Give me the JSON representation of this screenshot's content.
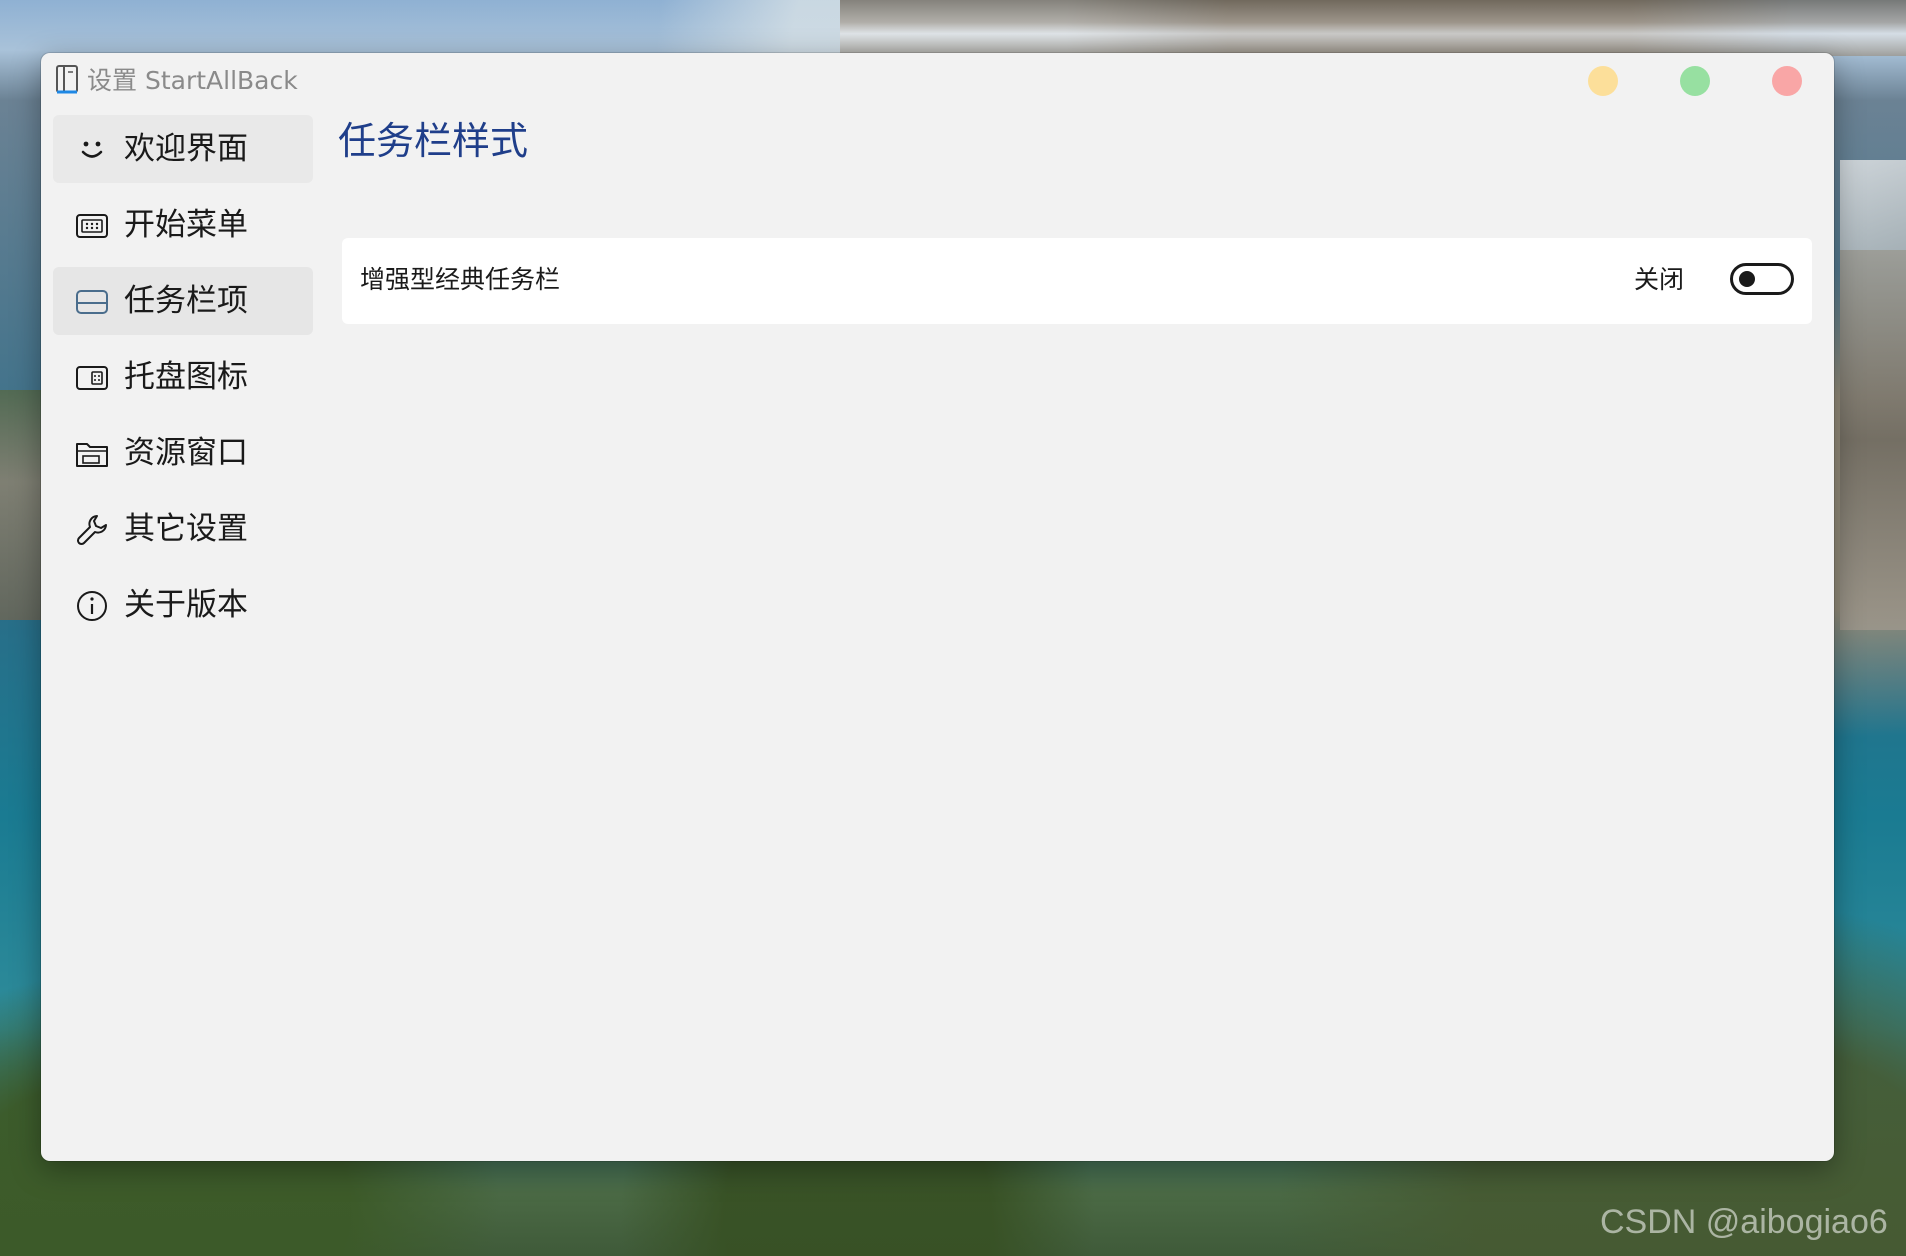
{
  "window": {
    "title": "设置 StartAllBack",
    "app_icon": "book-icon",
    "controls": {
      "minimize_color": "#fcdf9a",
      "maximize_color": "#97e0a1",
      "close_color": "#f9a6a6"
    }
  },
  "sidebar": {
    "items": [
      {
        "label": "欢迎界面",
        "icon": "smiley-icon",
        "state": "selected"
      },
      {
        "label": "开始菜单",
        "icon": "start-menu-icon",
        "state": ""
      },
      {
        "label": "任务栏项",
        "icon": "taskbar-icon",
        "state": "hovered"
      },
      {
        "label": "托盘图标",
        "icon": "tray-icon",
        "state": ""
      },
      {
        "label": "资源窗口",
        "icon": "folder-icon",
        "state": ""
      },
      {
        "label": "其它设置",
        "icon": "wrench-icon",
        "state": ""
      },
      {
        "label": "关于版本",
        "icon": "info-icon",
        "state": ""
      }
    ]
  },
  "main": {
    "page_title": "任务栏样式",
    "settings": [
      {
        "label": "增强型经典任务栏",
        "toggle_state_text": "关闭",
        "toggle_on": false
      }
    ]
  },
  "colors": {
    "title_accent": "#1f3e8a",
    "window_bg": "#f2f2f2",
    "card_bg": "#ffffff"
  },
  "watermark": "CSDN @aibogiao6"
}
